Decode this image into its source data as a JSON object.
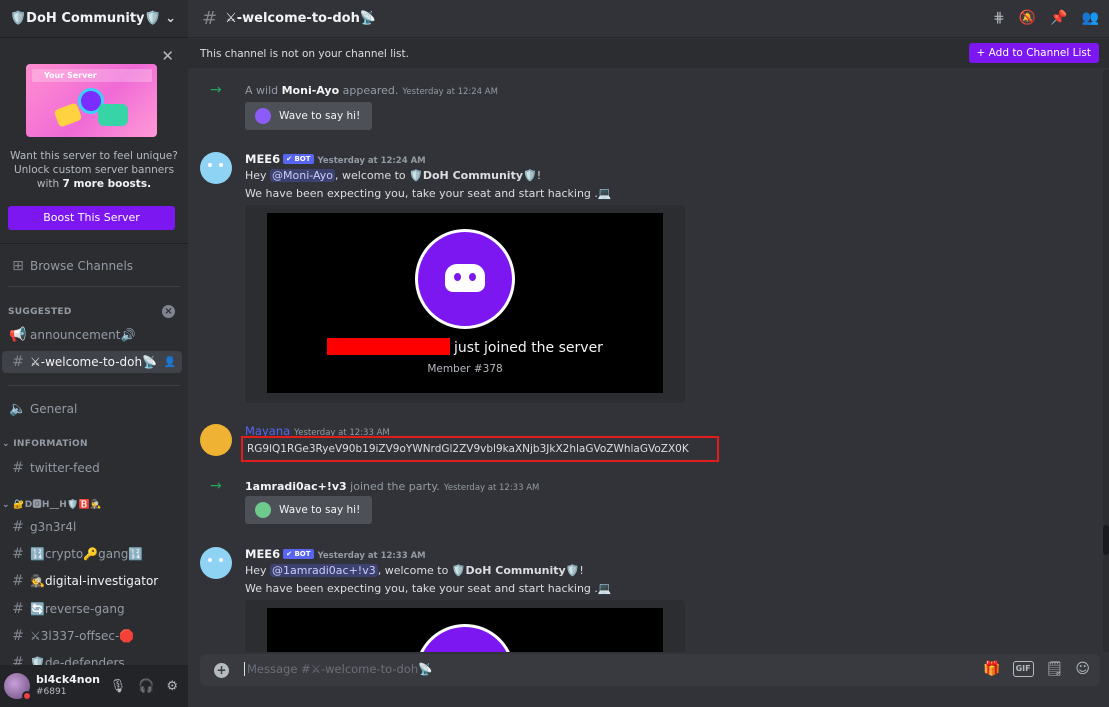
{
  "server": {
    "name": "🛡️DoH Community🛡️"
  },
  "boost": {
    "banner_label": "Your Server",
    "text_line1": "Want this server to feel unique?",
    "text_line2": "Unlock custom server banners",
    "text_line3_prefix": "with ",
    "text_line3_bold": "7 more boosts.",
    "button": "Boost This Server"
  },
  "sidebar": {
    "browse": "Browse Channels",
    "suggested_label": "SUGGESTED",
    "channels": [
      {
        "label": "announcement🔊"
      },
      {
        "label": "⚔-welcome-to-doh📡"
      },
      {
        "label": "General"
      }
    ],
    "info_category": "INFORMATiON",
    "info_channels": [
      {
        "label": "twitter-feed"
      }
    ],
    "gang_category": "🔐D🅾H__H🛡️🅱️🕵️‍♂️",
    "gang_channels": [
      {
        "label": "g3n3r4l"
      },
      {
        "label": "🔢crypto🔑gang🔢"
      },
      {
        "label": "🕵️digital-investigator"
      },
      {
        "label": "🔄reverse-gang"
      },
      {
        "label": "⚔3l337-offsec-🛑"
      },
      {
        "label": "🛡️de-defenders"
      }
    ]
  },
  "user": {
    "name": "bl4ck4non",
    "tag": "#6891"
  },
  "channel": {
    "title": "⚔-welcome-to-doh📡",
    "notice": "This channel is not on your channel list.",
    "add_button": "+ Add to Channel List"
  },
  "messages": {
    "m1": {
      "prefix": "A wild ",
      "user": "Moni-Ayo",
      "suffix": " appeared.",
      "time": "Yesterday at 12:24 AM",
      "wave": "Wave to say hi!"
    },
    "m2": {
      "user": "MEE6",
      "badge": "✔ BOT",
      "time": "Yesterday at 12:24 AM",
      "hey": "Hey ",
      "mention": "@Moni-Ayo",
      "welcome": ", welcome to ",
      "community": "🛡️DoH Community🛡️",
      "bang": "!",
      "line2": "We have been expecting you, take your seat and start hacking .💻",
      "joined": "just joined the server",
      "member": "Member #378"
    },
    "m3": {
      "user": "Mayana",
      "time": "Yesterday at 12:33 AM",
      "code": "RG9lQ1RGe3RyeV90b19iZV9oYWNrdGl2ZV9vbl9kaXNjb3JkX2hlaGVoZWhlaGVoZX0K"
    },
    "m4": {
      "user": "1amradi0ac+!v3",
      "suffix": " joined the party.",
      "time": "Yesterday at 12:33 AM",
      "wave": "Wave to say hi!"
    },
    "m5": {
      "user": "MEE6",
      "badge": "✔ BOT",
      "time": "Yesterday at 12:33 AM",
      "hey": "Hey ",
      "mention": "@1amradi0ac+!v3",
      "welcome": ", welcome to ",
      "community": "🛡️DoH Community🛡️",
      "bang": "!",
      "line2": "We have been expecting you, take your seat and start hacking .💻"
    }
  },
  "composer": {
    "placeholder": "Message #⚔-welcome-to-doh📡"
  },
  "colors": {
    "accent": "#7c17f2",
    "blurple": "#5865f2",
    "online_green": "#23a55a",
    "highlight_red": "#e31c1c"
  }
}
